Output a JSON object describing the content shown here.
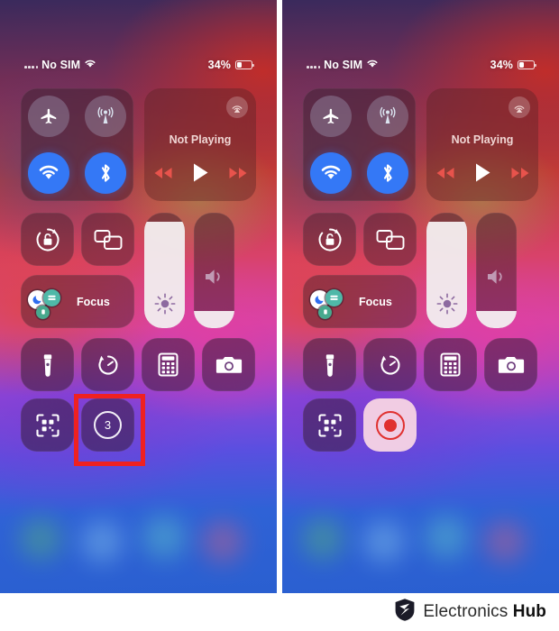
{
  "page": {
    "title": "iOS Control Center — Screen Recording",
    "panel_count": 2
  },
  "status_bar": {
    "carrier": "No SIM",
    "wifi_icon": "wifi-icon",
    "signal_dots_icon": "signal-dots-icon",
    "battery_percent": "34%",
    "battery_level": 34,
    "battery_icon": "battery-icon"
  },
  "connectivity": {
    "airplane": {
      "name": "airplane-mode-toggle",
      "icon": "airplane-icon",
      "state": "off"
    },
    "cellular": {
      "name": "cellular-data-toggle",
      "icon": "cellular-antenna-icon",
      "state": "off"
    },
    "wifi": {
      "name": "wifi-toggle",
      "icon": "wifi-icon",
      "state": "on"
    },
    "bluetooth": {
      "name": "bluetooth-toggle",
      "icon": "bluetooth-icon",
      "state": "on"
    }
  },
  "media": {
    "airplay_icon": "airplay-icon",
    "now_playing": "Not Playing",
    "rewind_icon": "rewind-icon",
    "play_icon": "play-icon",
    "forward_icon": "fast-forward-icon"
  },
  "tiles": {
    "rotation_lock": {
      "label": "Rotation Lock",
      "icon": "rotation-lock-icon"
    },
    "screen_mirroring": {
      "label": "Screen Mirroring",
      "icon": "screen-mirroring-icon"
    },
    "focus": {
      "label": "Focus",
      "icons": [
        "moon-icon",
        "sleep-icon",
        "personal-icon"
      ]
    }
  },
  "sliders": {
    "brightness": {
      "label": "Brightness",
      "icon": "brightness-sun-icon",
      "value": 92
    },
    "volume": {
      "label": "Volume",
      "icon": "speaker-volume-icon",
      "value": 15
    }
  },
  "utilities": [
    {
      "label": "Flashlight",
      "icon": "flashlight-icon"
    },
    {
      "label": "Timer",
      "icon": "timer-icon"
    },
    {
      "label": "Calculator",
      "icon": "calculator-icon"
    },
    {
      "label": "Camera",
      "icon": "camera-icon"
    },
    {
      "label": "Code Scanner",
      "icon": "qr-scanner-icon"
    }
  ],
  "screen_recording": {
    "left_panel": {
      "icon": "screen-record-countdown-icon",
      "countdown": "3",
      "state": "counting-down",
      "highlighted": true
    },
    "right_panel": {
      "icon": "screen-record-active-icon",
      "state": "recording",
      "highlighted": false
    }
  },
  "highlight": {
    "color": "#ef2121",
    "border_width": 5
  },
  "colors": {
    "accent_blue": "#3478f6",
    "record_red": "#e0302f",
    "highlight_red": "#ef2121",
    "brand_dark": "#111111"
  },
  "branding": {
    "logo_icon": "shield-logo-icon",
    "name_light": "Electronics ",
    "name_bold": "Hub"
  }
}
